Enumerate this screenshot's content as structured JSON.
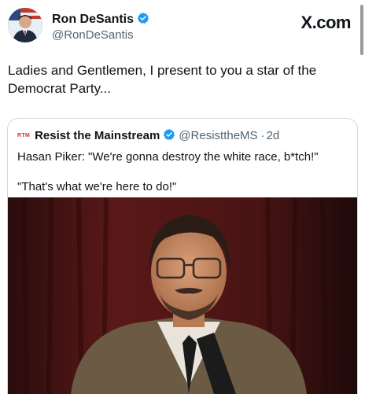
{
  "tweet": {
    "author": {
      "name": "Ron DeSantis",
      "handle": "@RonDeSantis"
    },
    "brand": "X.com",
    "text": "Ladies and Gentlemen, I present to you a star of the Democrat Party..."
  },
  "quoted_tweet": {
    "logo_text": "RTM",
    "author_name": "Resist the Mainstream",
    "handle": "@ResisttheMS",
    "separator": "·",
    "time": "2d",
    "lines": [
      "Hasan Piker: \"We're gonna destroy the white race, b*tch!\"",
      "\"That's what we're here to do!\""
    ]
  },
  "colors": {
    "verified_badge": "#1d9bf0",
    "text": "#0f1419",
    "muted": "#536471",
    "border": "#cfd9de"
  },
  "icons": {
    "verified": "verified-badge-icon"
  }
}
